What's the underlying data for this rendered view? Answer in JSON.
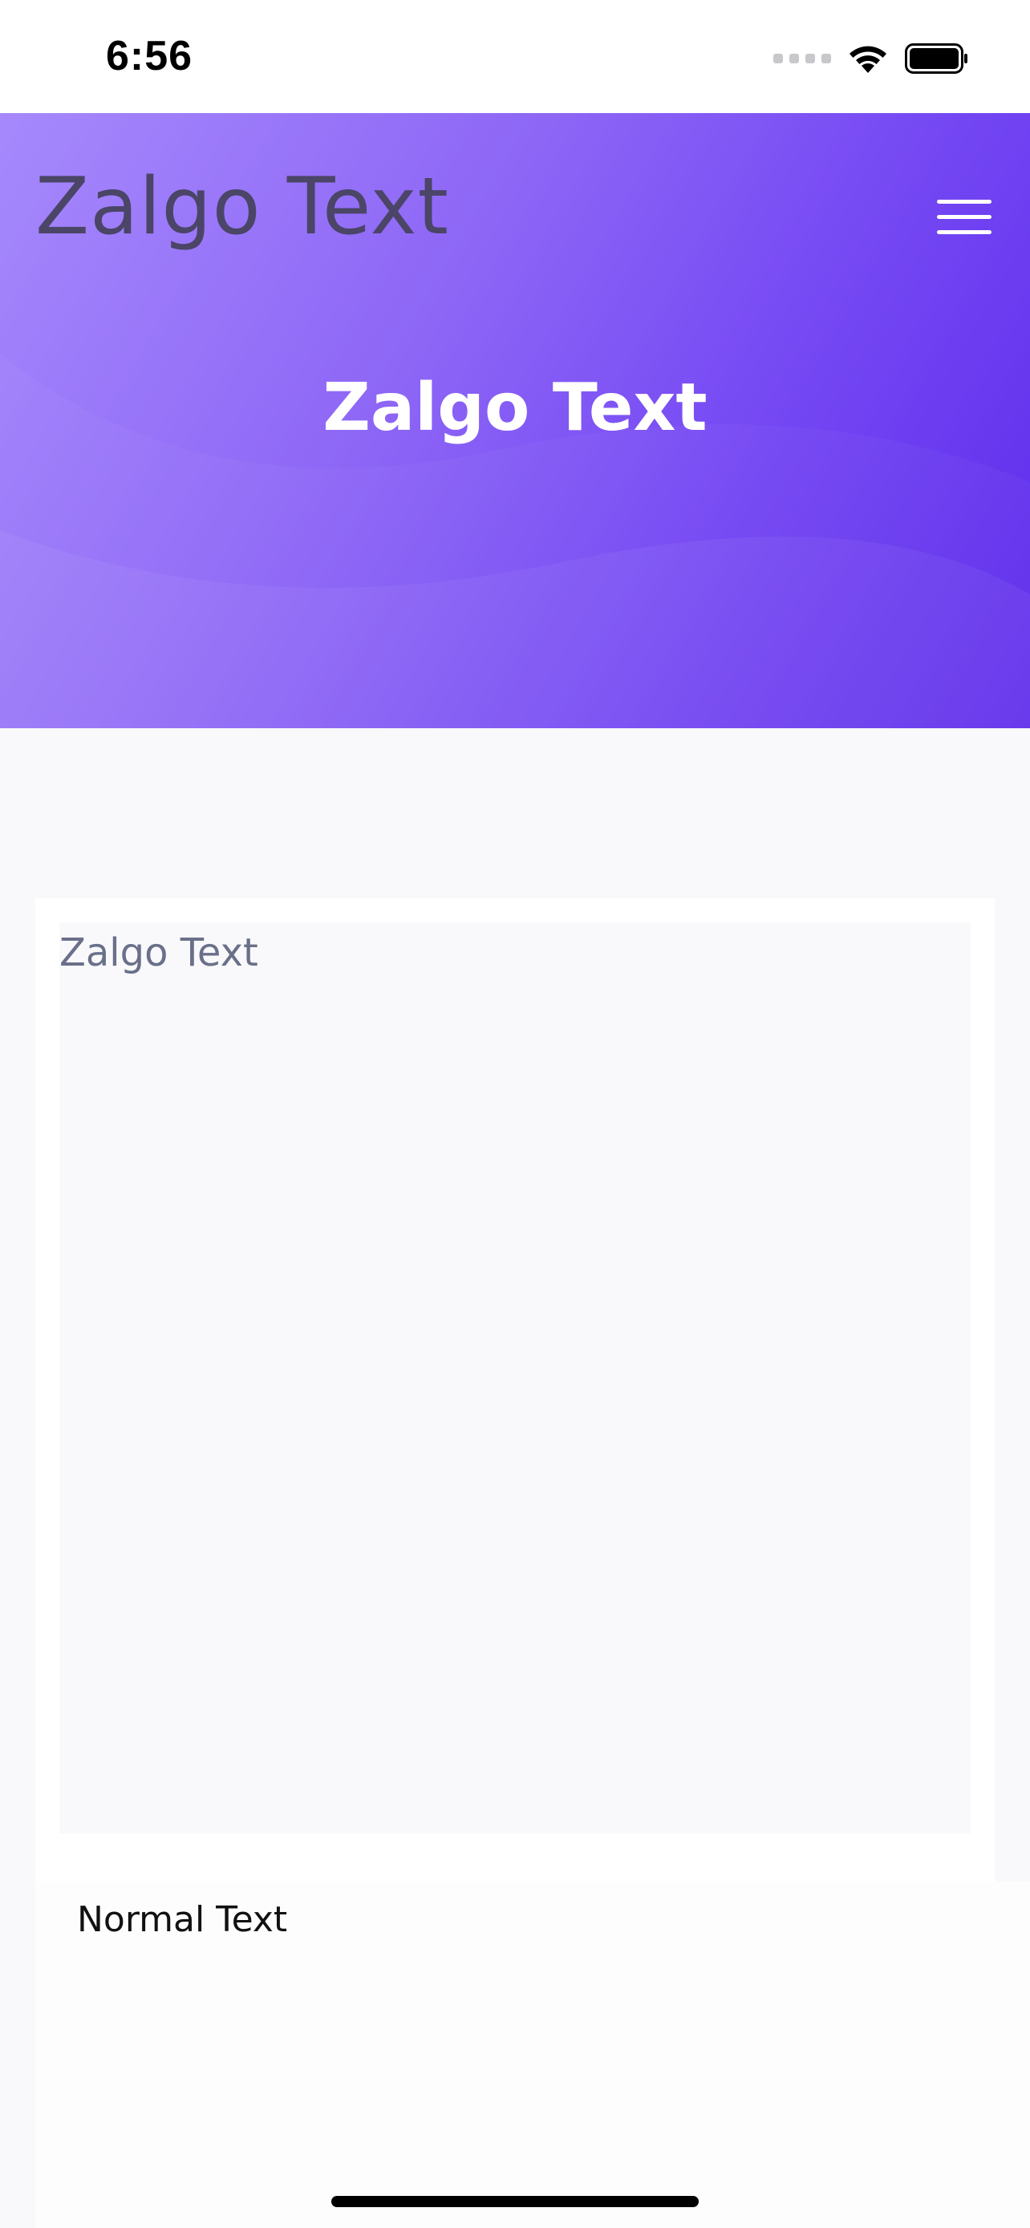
{
  "status_bar": {
    "time": "6:56"
  },
  "header": {
    "brand": "Zalgo Text",
    "menu_icon": "hamburger-menu-icon"
  },
  "hero": {
    "title": "Zalgo Text"
  },
  "converter": {
    "input_placeholder": "Zalgo Text",
    "input_value": "",
    "output_placeholder": "Normal Text"
  },
  "colors": {
    "hero_gradient_start": "#a689fc",
    "hero_gradient_end": "#5d2aeb",
    "brand_text": "#4b4567",
    "page_background": "#f9f9fb"
  }
}
